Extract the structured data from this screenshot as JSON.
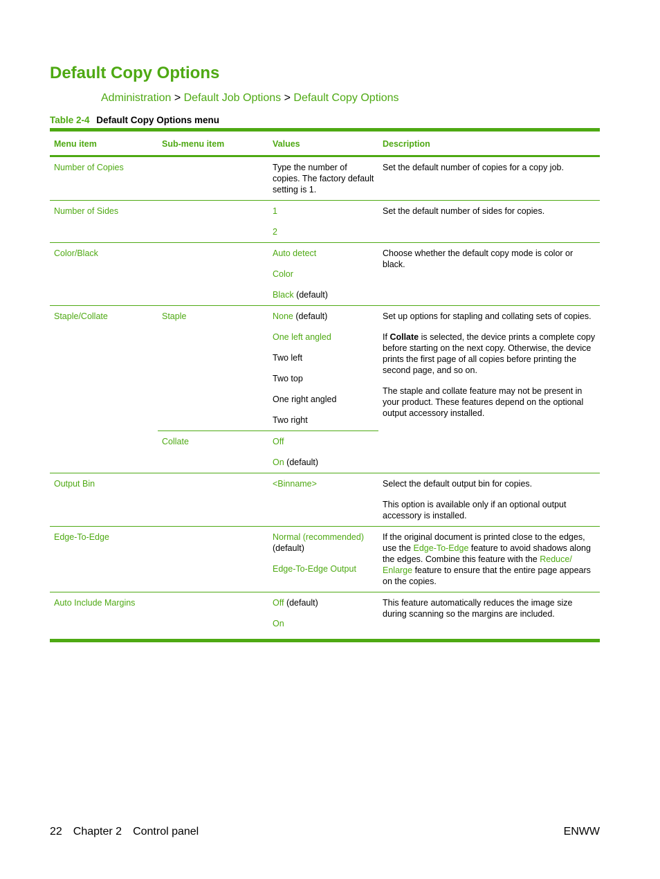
{
  "page": {
    "title": "Default Copy Options",
    "breadcrumb": [
      "Administration",
      "Default Job Options",
      "Default Copy Options"
    ],
    "breadcrumb_separator": ">",
    "table_caption_number": "Table 2-4",
    "table_caption_text": "Default Copy Options menu",
    "accent_color": "#4ea913"
  },
  "table": {
    "headers": [
      "Menu item",
      "Sub-menu item",
      "Values",
      "Description"
    ],
    "rows": {
      "copies": {
        "menu": "Number of Copies",
        "values": [
          "Type the number of copies. The factory default setting is 1."
        ],
        "description": [
          "Set the default number of copies for a copy job."
        ]
      },
      "sides": {
        "menu": "Number of Sides",
        "values": [
          "1",
          "2"
        ],
        "description": [
          "Set the default number of sides for copies."
        ]
      },
      "color": {
        "menu": "Color/Black",
        "values": [
          "Auto detect",
          "Color",
          "Black"
        ],
        "default_suffix": "(default)",
        "description": [
          "Choose whether the default copy mode is color or black."
        ]
      },
      "staple": {
        "menu": "Staple/Collate",
        "submenu_staple": "Staple",
        "staple_values": [
          "None",
          "One left angled",
          "Two left",
          "Two top",
          "One right angled",
          "Two right"
        ],
        "default_suffix": "(default)",
        "submenu_collate": "Collate",
        "collate_values": [
          "Off",
          "On"
        ],
        "description": [
          "Set up options for stapling and collating sets of copies.",
          "If",
          "Collate",
          "is selected, the device prints a complete copy before starting on the next copy. Otherwise, the device prints the first page of all copies before printing the second page, and so on.",
          "The staple and collate feature may not be present in your product. These features depend on the optional output accessory installed."
        ]
      },
      "bin": {
        "menu": "Output Bin",
        "values": [
          "<Binname>"
        ],
        "description": [
          "Select the default output bin for copies.",
          "This option is available only if an optional output accessory is installed."
        ]
      },
      "edge": {
        "menu": "Edge-To-Edge",
        "values": [
          "Normal (recommended)",
          "(default)",
          "Edge-To-Edge Output"
        ],
        "description": [
          "If the original document is printed close to the edges, use the",
          "Edge-To-Edge",
          "feature to avoid shadows along the edges. Combine this feature with the",
          "Reduce/ Enlarge",
          "feature to ensure that the entire page appears on the copies."
        ]
      },
      "margins": {
        "menu": "Auto Include Margins",
        "values": [
          "Off",
          "On"
        ],
        "default_suffix": "(default)",
        "description": [
          "This feature automatically reduces the image size during scanning so the margins are included."
        ]
      }
    }
  },
  "footer": {
    "page_number": "22",
    "chapter": "Chapter 2",
    "section": "Control panel",
    "right": "ENWW"
  }
}
